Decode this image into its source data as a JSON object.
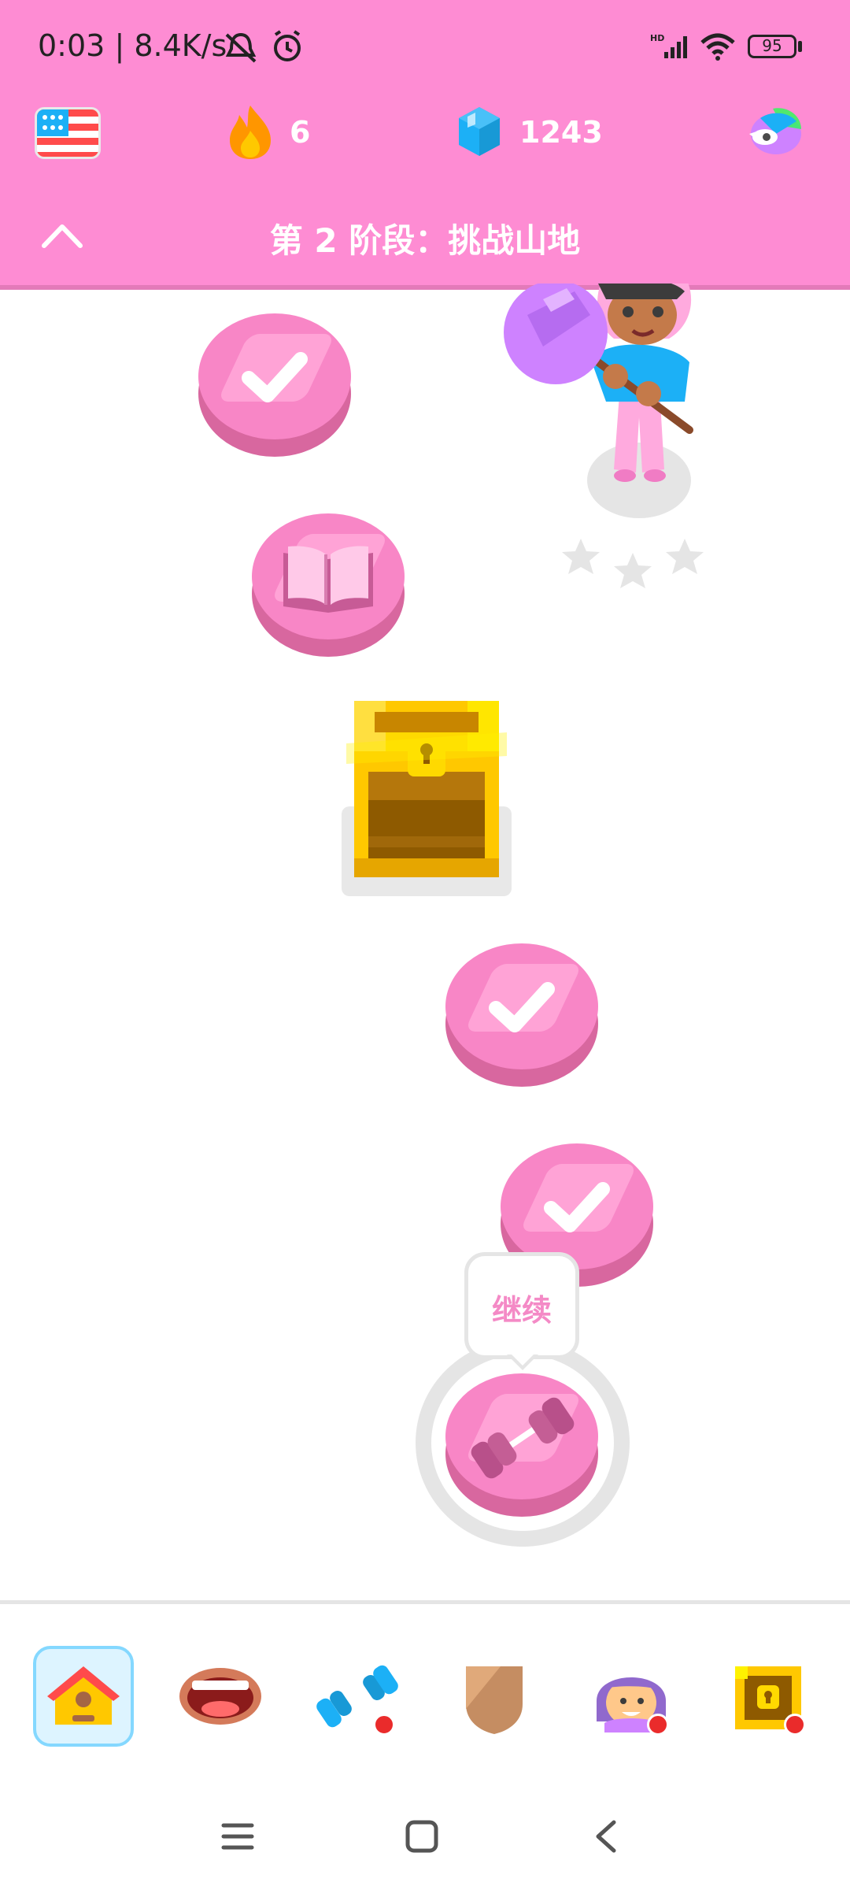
{
  "status_bar": {
    "time": "0:03",
    "speed": "8.4K/s",
    "battery": "95"
  },
  "header": {
    "course_flag": "us-flag-icon",
    "streak_count": "6",
    "gems_count": "1243",
    "stage_title": "第 2 阶段：挑战山地"
  },
  "path": {
    "tooltip_label": "继续",
    "nodes": [
      "completed",
      "story",
      "chest",
      "completed",
      "completed",
      "current-practice"
    ]
  },
  "bottom_nav": {
    "items": [
      "learn",
      "speak",
      "practice",
      "leagues",
      "profile",
      "shop"
    ],
    "active": "learn"
  },
  "colors": {
    "theme_pink": "#fe8cd3",
    "node_pink": "#f886c6",
    "node_dark": "#d8679f"
  }
}
